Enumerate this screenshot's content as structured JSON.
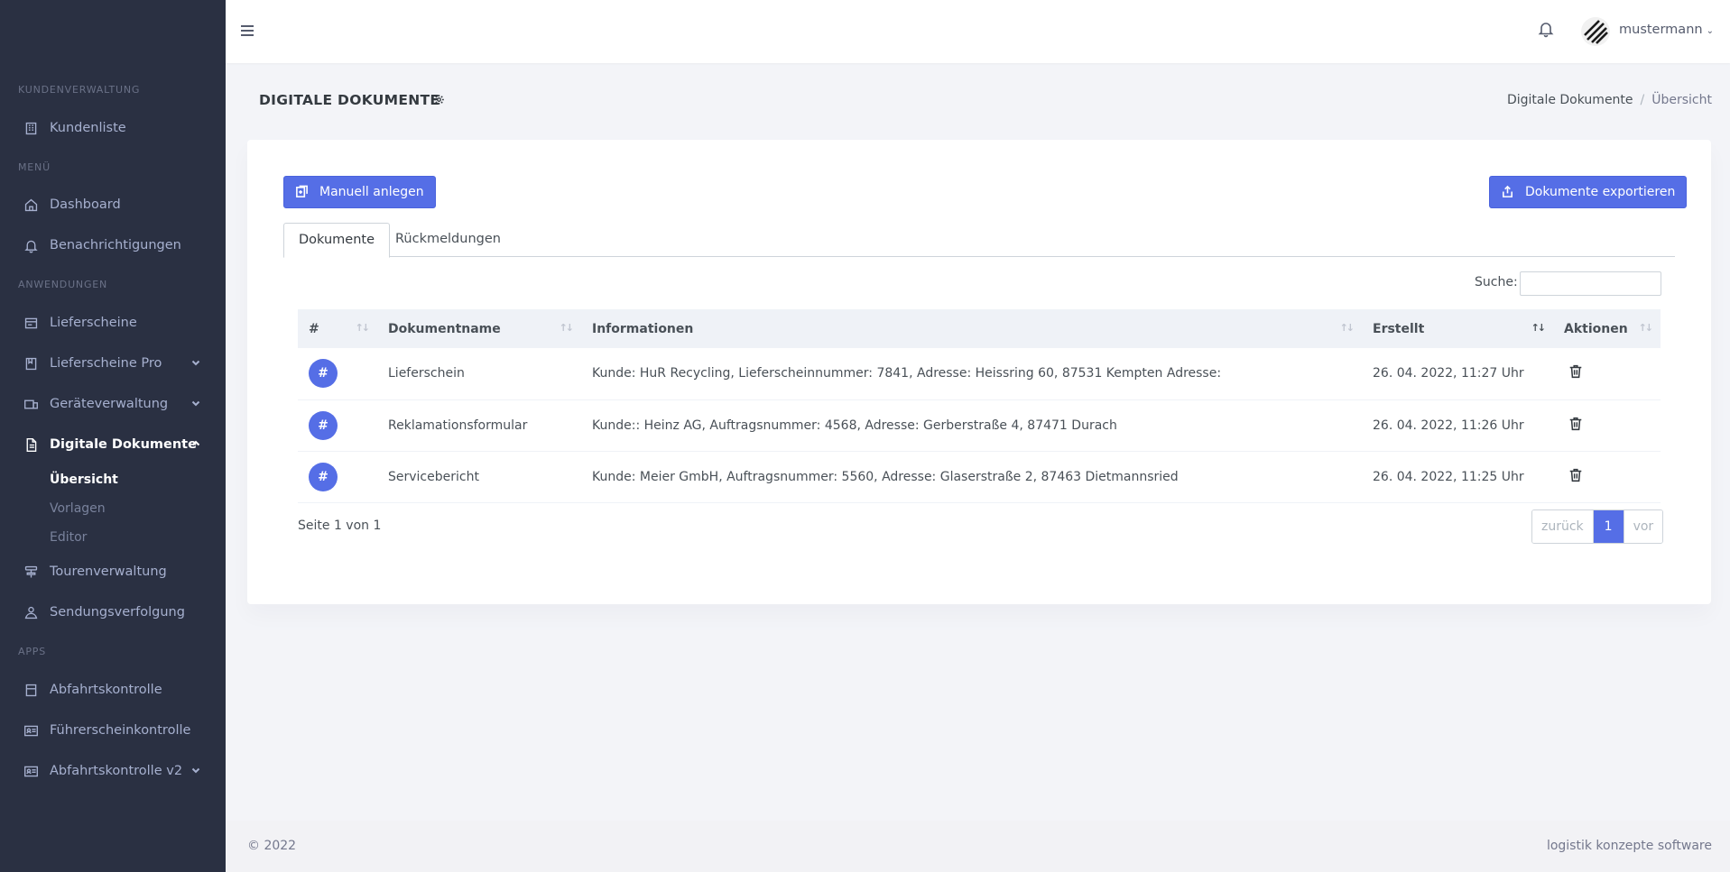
{
  "sidebar": {
    "sections": {
      "kunden": "KUNDENVERWALTUNG",
      "menu": "MENÜ",
      "anwendungen": "ANWENDUNGEN",
      "apps": "APPS"
    },
    "items": {
      "kundenliste": "Kundenliste",
      "dashboard": "Dashboard",
      "benachrichtigungen": "Benachrichtigungen",
      "lieferscheine": "Lieferscheine",
      "lieferscheine_pro": "Lieferscheine Pro",
      "geraeteverwaltung": "Geräteverwaltung",
      "digitale_dokumente": "Digitale Dokumente",
      "tourenverwaltung": "Tourenverwaltung",
      "sendungsverfolgung": "Sendungsverfolgung",
      "abfahrtskontrolle": "Abfahrtskontrolle",
      "fuehrerscheinkontrolle": "Führerscheinkontrolle",
      "abfahrtskontrolle_v2": "Abfahrtskontrolle v2"
    },
    "sub": {
      "uebersicht": "Übersicht",
      "vorlagen": "Vorlagen",
      "editor": "Editor"
    }
  },
  "topbar": {
    "username": "mustermann"
  },
  "page": {
    "title": "DIGITALE DOKUMENTE",
    "breadcrumb": [
      "Digitale Dokumente",
      "Übersicht"
    ]
  },
  "actions": {
    "manuell": "Manuell anlegen",
    "export": "Dokumente exportieren"
  },
  "tabs": [
    "Dokumente",
    "Rückmeldungen"
  ],
  "search": {
    "label": "Suche:",
    "value": ""
  },
  "table": {
    "headers": [
      "#",
      "Dokumentname",
      "Informationen",
      "Erstellt",
      "Aktionen"
    ],
    "rows": [
      {
        "badge": "#",
        "name": "Lieferschein",
        "info": "Kunde: HuR Recycling, Lieferscheinnummer: 7841, Adresse: Heissring 60, 87531 Kempten Adresse:",
        "created": "26. 04. 2022, 11:27 Uhr"
      },
      {
        "badge": "#",
        "name": "Reklamationsformular",
        "info": "Kunde:: Heinz AG, Auftragsnummer: 4568, Adresse: Gerberstraße 4, 87471 Durach",
        "created": "26. 04. 2022, 11:26 Uhr"
      },
      {
        "badge": "#",
        "name": "Servicebericht",
        "info": "Kunde: Meier GmbH, Auftragsnummer: 5560, Adresse: Glaserstraße 2, 87463 Dietmannsried",
        "created": "26. 04. 2022, 11:25 Uhr"
      }
    ]
  },
  "pagination": {
    "info": "Seite 1 von 1",
    "prev": "zurück",
    "current": "1",
    "next": "vor"
  },
  "footer": {
    "copyright": "© 2022",
    "brand": "logistik konzepte software"
  },
  "colors": {
    "sidebar_bg": "#2a3042",
    "primary": "#556ee6",
    "page_bg": "#f3f4f8"
  }
}
